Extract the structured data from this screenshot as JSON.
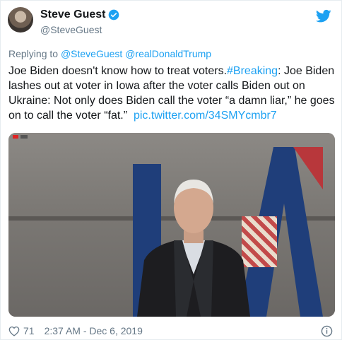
{
  "author": {
    "name": "Steve Guest",
    "handle": "@SteveGuest",
    "verified": true
  },
  "reply": {
    "prefix": "Replying to",
    "mentions": [
      "@SteveGuest",
      "@realDonaldTrump"
    ]
  },
  "tweet": {
    "text_part1": "Joe Biden doesn't know how to treat voters.",
    "hashtag": "#Breaking",
    "text_part2": ": Joe Biden lashes out at voter in Iowa after the voter calls Biden out on Ukraine: Not only does Biden call the voter “a damn liar,” he goes on to call the voter “fat.”",
    "link": "pic.twitter.com/34SMYcmbr7"
  },
  "footer": {
    "likes": "71",
    "timestamp": "2:37 AM - Dec 6, 2019"
  },
  "colors": {
    "accent": "#1da1f2",
    "secondary_text": "#657786",
    "primary_text": "#14171a"
  },
  "icons": [
    "verified-badge-icon",
    "twitter-bird-icon",
    "heart-icon",
    "info-icon"
  ]
}
